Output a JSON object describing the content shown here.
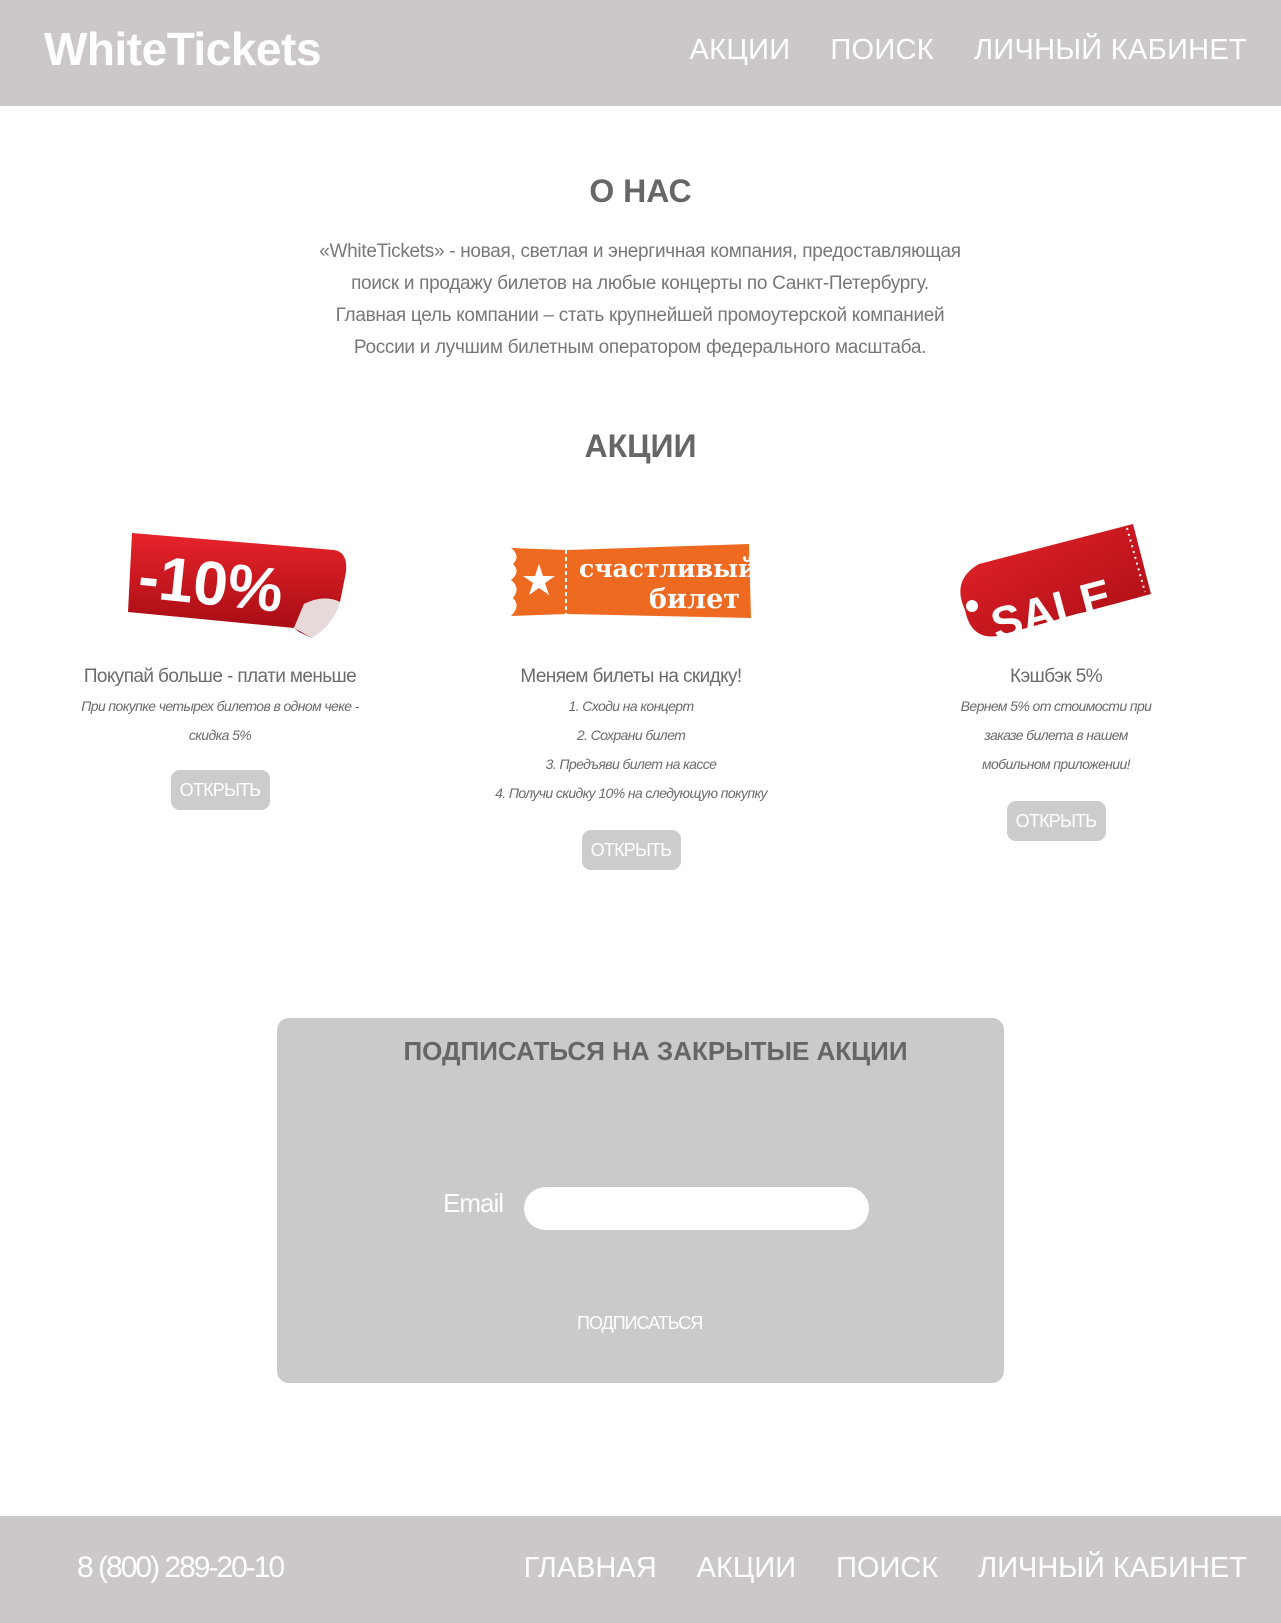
{
  "header": {
    "logo": "WhiteTickets",
    "nav": [
      "АКЦИИ",
      "ПОИСК",
      "ЛИЧНЫЙ КАБИНЕТ"
    ]
  },
  "about": {
    "title": "О НАС",
    "lines": [
      "«WhiteTickets» - новая, светлая и энергичная компания, предоставляющая",
      "поиск и продажу билетов на любые концерты по Санкт-Петербургу.",
      "Главная цель компании – стать крупнейшей промоутерской компанией",
      "России и лучшим билетным оператором федерального масштаба."
    ]
  },
  "promos": {
    "title": "АКЦИИ",
    "items": [
      {
        "sticker": "-10%",
        "title": "Покупай больше - плати меньше",
        "desc": [
          "При покупке четырех билетов в одном чеке - скидка 5%"
        ],
        "button": "ОТКРЫТЬ"
      },
      {
        "sticker_line1": "счастливый",
        "sticker_line2": "билет",
        "title": "Меняем билеты на скидку!",
        "desc": [
          "1. Сходи на концерт",
          "2. Сохрани билет",
          "3. Предъяви билет на кассе",
          "4. Получи скидку 10% на следующую покупку"
        ],
        "button": "ОТКРЫТЬ"
      },
      {
        "sticker": "SALE",
        "title": "Кэшбэк 5%",
        "desc": [
          "Вернем 5% от стоимости при",
          "заказе билета в нашем",
          "мобильном приложении!"
        ],
        "button": "ОТКРЫТЬ"
      }
    ]
  },
  "subscribe": {
    "title": "ПОДПИСАТЬСЯ НА ЗАКРЫТЫЕ АКЦИИ",
    "email_label": "Email",
    "email_value": "",
    "button": "ПОДПИСАТЬСЯ"
  },
  "footer": {
    "phone": "8 (800) 289-20-10",
    "nav": [
      "ГЛАВНАЯ",
      "АКЦИИ",
      "ПОИСК",
      "ЛИЧНЫЙ КАБИНЕТ"
    ]
  },
  "colors": {
    "bar": "#cdc8c8",
    "red": "#d4151d",
    "orange": "#ee6a21"
  }
}
